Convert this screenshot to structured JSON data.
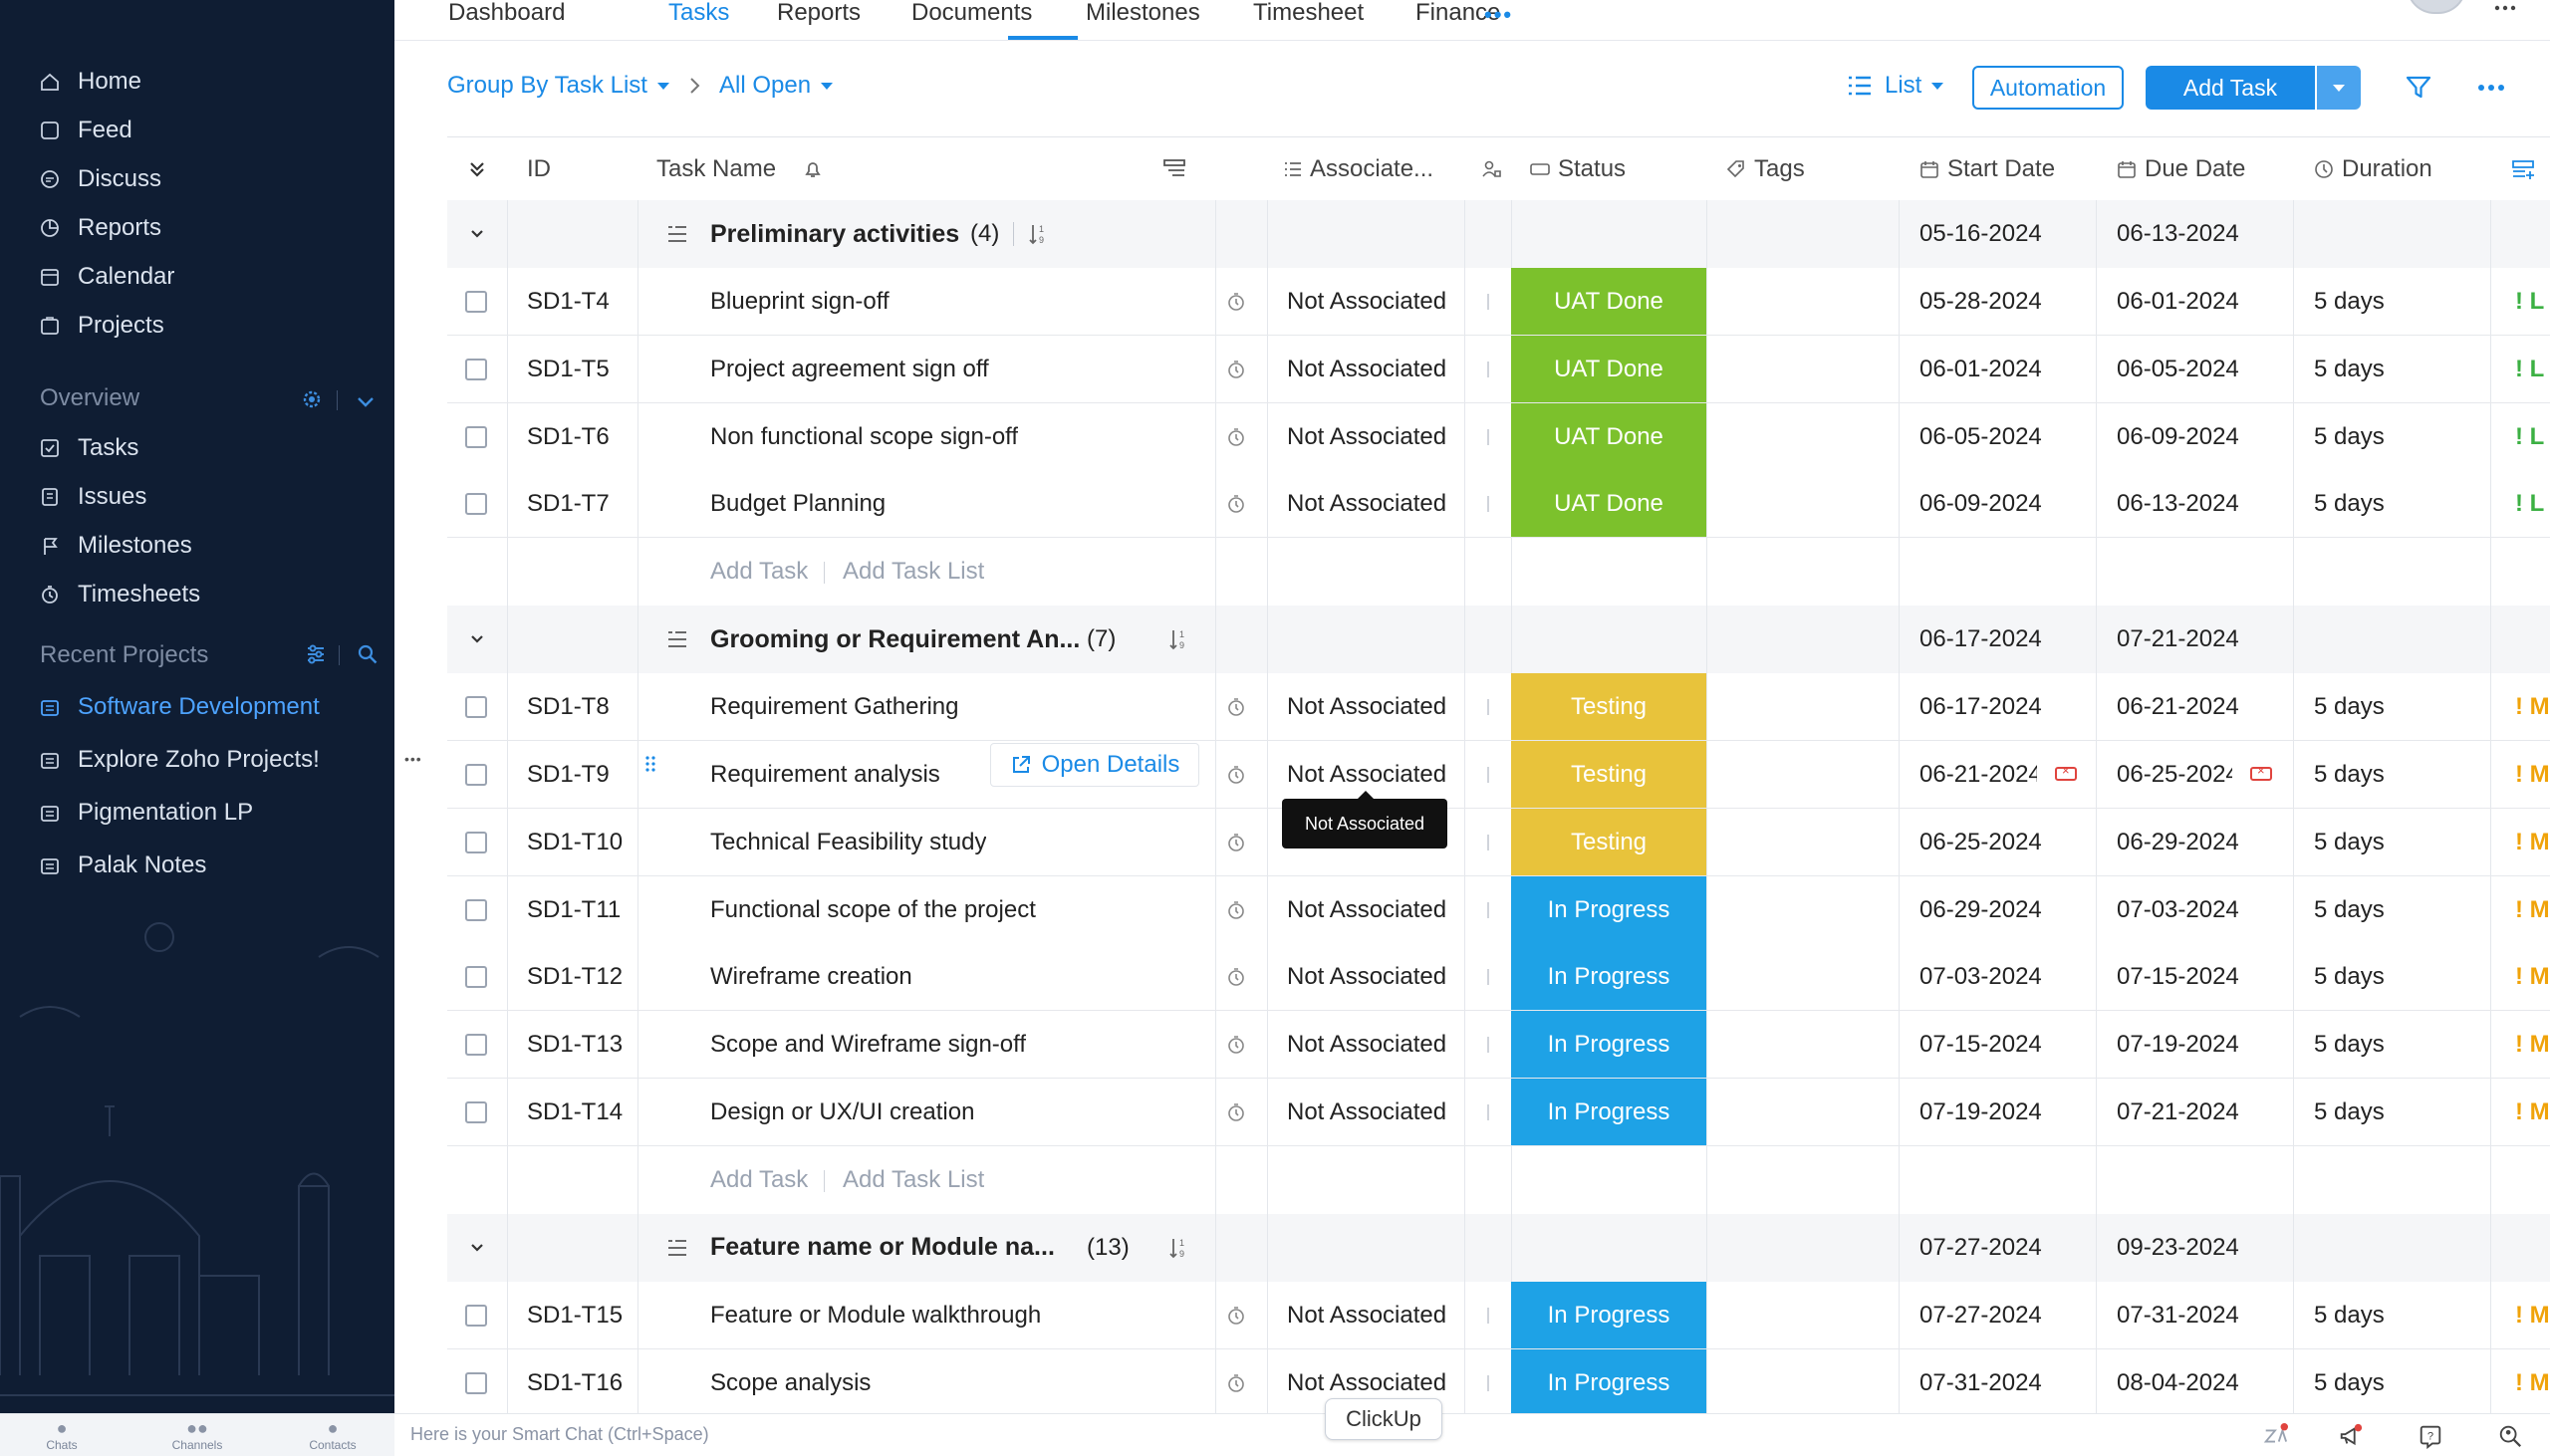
{
  "sidebar": {
    "nav": [
      {
        "label": "Home",
        "icon": "home-icon"
      },
      {
        "label": "Feed",
        "icon": "feed-icon"
      },
      {
        "label": "Discuss",
        "icon": "discuss-icon"
      },
      {
        "label": "Reports",
        "icon": "reports-icon"
      },
      {
        "label": "Calendar",
        "icon": "calendar-icon"
      },
      {
        "label": "Projects",
        "icon": "projects-icon"
      }
    ],
    "overview_title": "Overview",
    "overview_items": [
      {
        "label": "Tasks",
        "icon": "tasks-icon"
      },
      {
        "label": "Issues",
        "icon": "issues-icon"
      },
      {
        "label": "Milestones",
        "icon": "milestones-icon"
      },
      {
        "label": "Timesheets",
        "icon": "timesheets-icon"
      }
    ],
    "recent_title": "Recent Projects",
    "recent_projects": [
      {
        "label": "Software Development",
        "active": true
      },
      {
        "label": "Explore Zoho Projects!",
        "active": false
      },
      {
        "label": "Pigmentation LP",
        "active": false
      },
      {
        "label": "Palak Notes",
        "active": false
      }
    ],
    "more_label": "•••"
  },
  "tabs": [
    {
      "label": "Dashboard"
    },
    {
      "label": "Tasks",
      "active": true
    },
    {
      "label": "Reports"
    },
    {
      "label": "Documents"
    },
    {
      "label": "Milestones"
    },
    {
      "label": "Timesheet"
    },
    {
      "label": "Finance"
    }
  ],
  "toolbar": {
    "group_by": "Group By Task List",
    "filter_view": "All Open",
    "view_mode": "List",
    "automation": "Automation",
    "add_task": "Add Task"
  },
  "columns": {
    "id": "ID",
    "task_name": "Task Name",
    "associated": "Associate...",
    "status": "Status",
    "tags": "Tags",
    "start_date": "Start Date",
    "due_date": "Due Date",
    "duration": "Duration"
  },
  "groups": [
    {
      "name": "Preliminary activities",
      "count": "(4)",
      "start": "05-16-2024",
      "due": "06-13-2024",
      "tasks": [
        {
          "id": "SD1-T4",
          "name": "Blueprint sign-off",
          "assoc": "Not Associated",
          "status": "UAT Done",
          "status_color": "#7cc12c",
          "start": "05-28-2024",
          "due": "06-01-2024",
          "duration": "5 days",
          "prio": "! L"
        },
        {
          "id": "SD1-T5",
          "name": "Project agreement sign off",
          "assoc": "Not Associated",
          "status": "UAT Done",
          "status_color": "#7cc12c",
          "start": "06-01-2024",
          "due": "06-05-2024",
          "duration": "5 days",
          "prio": "! L"
        },
        {
          "id": "SD1-T6",
          "name": "Non functional scope sign-off",
          "assoc": "Not Associated",
          "status": "UAT Done",
          "status_color": "#7cc12c",
          "start": "06-05-2024",
          "due": "06-09-2024",
          "duration": "5 days",
          "prio": "! L"
        },
        {
          "id": "SD1-T7",
          "name": "Budget Planning",
          "assoc": "Not Associated",
          "status": "UAT Done",
          "status_color": "#7cc12c",
          "start": "06-09-2024",
          "due": "06-13-2024",
          "duration": "5 days",
          "prio": "! L"
        }
      ],
      "add_task": "Add Task",
      "add_task_list": "Add Task List"
    },
    {
      "name": "Grooming or Requirement An...",
      "count": "(7)",
      "start": "06-17-2024",
      "due": "07-21-2024",
      "tasks": [
        {
          "id": "SD1-T8",
          "name": "Requirement Gathering",
          "assoc": "Not Associated",
          "status": "Testing",
          "status_color": "#e8c33b",
          "start": "06-17-2024",
          "due": "06-21-2024",
          "duration": "5 days",
          "prio": "! M"
        },
        {
          "id": "SD1-T9",
          "name": "Requirement analysis",
          "assoc": "Not Associated",
          "status": "Testing",
          "status_color": "#e8c33b",
          "start": "06-21-2024",
          "due": "06-25-2024",
          "duration": "5 days",
          "prio": "! M",
          "overdue": true
        },
        {
          "id": "SD1-T10",
          "name": "Technical Feasibility study",
          "assoc": "",
          "status": "Testing",
          "status_color": "#e8c33b",
          "start": "06-25-2024",
          "due": "06-29-2024",
          "duration": "5 days",
          "prio": "! M"
        },
        {
          "id": "SD1-T11",
          "name": "Functional scope of the project",
          "assoc": "Not Associated",
          "status": "In Progress",
          "status_color": "#1ea2e6",
          "start": "06-29-2024",
          "due": "07-03-2024",
          "duration": "5 days",
          "prio": "! M"
        },
        {
          "id": "SD1-T12",
          "name": "Wireframe creation",
          "assoc": "Not Associated",
          "status": "In Progress",
          "status_color": "#1ea2e6",
          "start": "07-03-2024",
          "due": "07-15-2024",
          "duration": "5 days",
          "prio": "! M"
        },
        {
          "id": "SD1-T13",
          "name": "Scope and Wireframe sign-off",
          "assoc": "Not Associated",
          "status": "In Progress",
          "status_color": "#1ea2e6",
          "start": "07-15-2024",
          "due": "07-19-2024",
          "duration": "5 days",
          "prio": "! M"
        },
        {
          "id": "SD1-T14",
          "name": "Design or UX/UI creation",
          "assoc": "Not Associated",
          "status": "In Progress",
          "status_color": "#1ea2e6",
          "start": "07-19-2024",
          "due": "07-21-2024",
          "duration": "5 days",
          "prio": "! M"
        }
      ],
      "add_task": "Add Task",
      "add_task_list": "Add Task List"
    },
    {
      "name": "Feature name or Module na...",
      "count": "(13)",
      "start": "07-27-2024",
      "due": "09-23-2024",
      "tasks": [
        {
          "id": "SD1-T15",
          "name": "Feature or Module walkthrough",
          "assoc": "Not Associated",
          "status": "In Progress",
          "status_color": "#1ea2e6",
          "start": "07-27-2024",
          "due": "07-31-2024",
          "duration": "5 days",
          "prio": "! M"
        },
        {
          "id": "SD1-T16",
          "name": "Scope analysis",
          "assoc": "Not Associated",
          "status": "In Progress",
          "status_color": "#1ea2e6",
          "start": "07-31-2024",
          "due": "08-04-2024",
          "duration": "5 days",
          "prio": "! M"
        }
      ]
    }
  ],
  "open_details": "Open Details",
  "tooltip": "Not Associated",
  "bottom": {
    "chats": "Chats",
    "channels": "Channels",
    "contacts": "Contacts",
    "smart_chat": "Here is your Smart Chat (Ctrl+Space)",
    "clickup": "ClickUp"
  }
}
